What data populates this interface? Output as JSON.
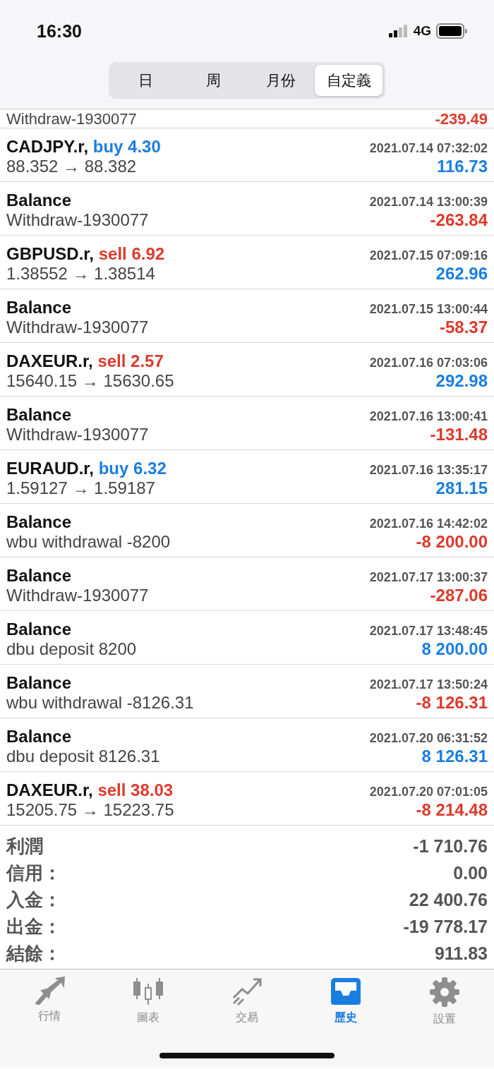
{
  "status_bar": {
    "time": "16:30",
    "network": "4G"
  },
  "period_tabs": [
    {
      "label": "日",
      "selected": false
    },
    {
      "label": "周",
      "selected": false
    },
    {
      "label": "月份",
      "selected": false
    },
    {
      "label": "自定義",
      "selected": true
    }
  ],
  "partial_row": {
    "detail": "Withdraw-1930077",
    "amount": "-239.49",
    "profit": false
  },
  "deals": [
    {
      "kind": "buy",
      "title": "CADJPY.r,",
      "order": "buy 4.30",
      "time": "2021.07.14 07:32:02",
      "detail": "88.352 → 88.382",
      "amount": "116.73",
      "profit": true
    },
    {
      "kind": "balance",
      "title": "Balance",
      "time": "2021.07.14 13:00:39",
      "detail": "Withdraw-1930077",
      "amount": "-263.84",
      "profit": false
    },
    {
      "kind": "sell",
      "title": "GBPUSD.r,",
      "order": "sell 6.92",
      "time": "2021.07.15 07:09:16",
      "detail": "1.38552 → 1.38514",
      "amount": "262.96",
      "profit": true
    },
    {
      "kind": "balance",
      "title": "Balance",
      "time": "2021.07.15 13:00:44",
      "detail": "Withdraw-1930077",
      "amount": "-58.37",
      "profit": false
    },
    {
      "kind": "sell",
      "title": "DAXEUR.r,",
      "order": "sell 2.57",
      "time": "2021.07.16 07:03:06",
      "detail": "15640.15 → 15630.65",
      "amount": "292.98",
      "profit": true
    },
    {
      "kind": "balance",
      "title": "Balance",
      "time": "2021.07.16 13:00:41",
      "detail": "Withdraw-1930077",
      "amount": "-131.48",
      "profit": false
    },
    {
      "kind": "buy",
      "title": "EURAUD.r,",
      "order": "buy 6.32",
      "time": "2021.07.16 13:35:17",
      "detail": "1.59127 → 1.59187",
      "amount": "281.15",
      "profit": true
    },
    {
      "kind": "balance",
      "title": "Balance",
      "time": "2021.07.16 14:42:02",
      "detail": "wbu withdrawal -8200",
      "amount": "-8 200.00",
      "profit": false
    },
    {
      "kind": "balance",
      "title": "Balance",
      "time": "2021.07.17 13:00:37",
      "detail": "Withdraw-1930077",
      "amount": "-287.06",
      "profit": false
    },
    {
      "kind": "balance",
      "title": "Balance",
      "time": "2021.07.17 13:48:45",
      "detail": "dbu deposit 8200",
      "amount": "8 200.00",
      "profit": true
    },
    {
      "kind": "balance",
      "title": "Balance",
      "time": "2021.07.17 13:50:24",
      "detail": "wbu withdrawal -8126.31",
      "amount": "-8 126.31",
      "profit": false
    },
    {
      "kind": "balance",
      "title": "Balance",
      "time": "2021.07.20 06:31:52",
      "detail": "dbu deposit 8126.31",
      "amount": "8 126.31",
      "profit": true
    },
    {
      "kind": "sell",
      "title": "DAXEUR.r,",
      "order": "sell 38.03",
      "time": "2021.07.20 07:01:05",
      "detail": "15205.75 → 15223.75",
      "amount": "-8 214.48",
      "profit": false
    }
  ],
  "summary": [
    {
      "label": "利潤",
      "value": "-1 710.76"
    },
    {
      "label": "信用：",
      "value": "0.00"
    },
    {
      "label": "入金：",
      "value": "22 400.76"
    },
    {
      "label": "出金：",
      "value": "-19 778.17"
    },
    {
      "label": "結餘：",
      "value": "911.83"
    }
  ],
  "tab_bar": [
    {
      "kind": "quotes",
      "label": "行情",
      "selected": false
    },
    {
      "kind": "chart",
      "label": "圖表",
      "selected": false
    },
    {
      "kind": "trade",
      "label": "交易",
      "selected": false
    },
    {
      "kind": "history",
      "label": "歷史",
      "selected": true
    },
    {
      "kind": "settings",
      "label": "設置",
      "selected": false
    }
  ]
}
